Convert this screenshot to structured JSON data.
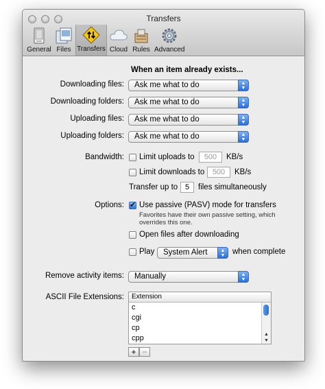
{
  "window": {
    "title": "Transfers"
  },
  "toolbar": {
    "items": [
      {
        "label": "General",
        "icon": "general-icon"
      },
      {
        "label": "Files",
        "icon": "files-icon"
      },
      {
        "label": "Transfers",
        "icon": "transfers-icon",
        "selected": true
      },
      {
        "label": "Cloud",
        "icon": "cloud-icon"
      },
      {
        "label": "Rules",
        "icon": "rules-icon"
      },
      {
        "label": "Advanced",
        "icon": "gear-icon"
      }
    ]
  },
  "exists": {
    "heading": "When an item already exists...",
    "downloading_files_label": "Downloading files:",
    "downloading_files_value": "Ask me what to do",
    "downloading_folders_label": "Downloading folders:",
    "downloading_folders_value": "Ask me what to do",
    "uploading_files_label": "Uploading files:",
    "uploading_files_value": "Ask me what to do",
    "uploading_folders_label": "Uploading folders:",
    "uploading_folders_value": "Ask me what to do"
  },
  "bandwidth": {
    "label": "Bandwidth:",
    "limit_uploads_label": "Limit uploads to",
    "limit_uploads_value": "500",
    "limit_uploads_checked": false,
    "limit_downloads_label": "Limit downloads to",
    "limit_downloads_value": "500",
    "limit_downloads_checked": false,
    "unit": "KB/s",
    "transfer_prefix": "Transfer up to",
    "transfer_value": "5",
    "transfer_suffix": "files simultaneously"
  },
  "options": {
    "label": "Options:",
    "passive_label": "Use passive (PASV) mode for transfers",
    "passive_checked": true,
    "passive_note_line1": "Favorites have their own passive setting, which",
    "passive_note_line2": "overrides this one.",
    "open_files_label": "Open files after downloading",
    "open_files_checked": false,
    "play_label": "Play",
    "play_checked": false,
    "play_sound": "System Alert",
    "play_suffix": "when complete"
  },
  "activity": {
    "label": "Remove activity items:",
    "value": "Manually"
  },
  "ascii": {
    "label": "ASCII File Extensions:",
    "column_header": "Extension",
    "items": [
      "c",
      "cgi",
      "cp",
      "cpp"
    ],
    "add_label": "+",
    "remove_label": "−"
  },
  "colors": {
    "accent": "#2f74d8",
    "window_bg": "#ececec"
  }
}
